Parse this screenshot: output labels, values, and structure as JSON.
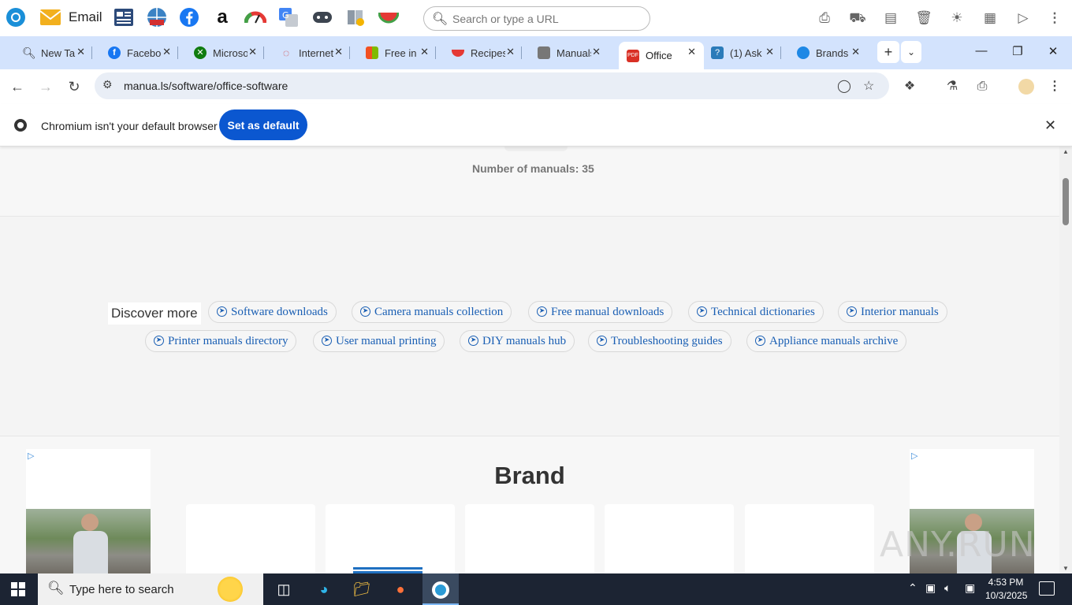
{
  "appbar": {
    "email_label": "Email",
    "search_placeholder": "Search or type a URL"
  },
  "tabs": [
    {
      "title": "New Tab",
      "icon": "search-icon",
      "color": "#333333"
    },
    {
      "title": "Facebook",
      "icon": "facebook-icon",
      "color": "#1877f2"
    },
    {
      "title": "Microsoft",
      "icon": "xbox-icon",
      "color": "#107c10"
    },
    {
      "title": "Internet",
      "icon": "speedometer-icon",
      "color": "#d32f2f"
    },
    {
      "title": "Free in",
      "icon": "microsoft-logo-icon",
      "color": "#f25022"
    },
    {
      "title": "Recipes",
      "icon": "watermelon-icon",
      "color": "#e53935"
    },
    {
      "title": "Manuals",
      "icon": "manual-icon",
      "color": "#555555"
    },
    {
      "title": "Office s",
      "icon": "pdf-icon",
      "color": "#d93025"
    },
    {
      "title": "(1) Ask",
      "icon": "ask-icon",
      "color": "#2b7bb9"
    },
    {
      "title": "Brands",
      "icon": "brands-icon",
      "color": "#1e88e5"
    }
  ],
  "toolbar": {
    "url": "manua.ls/software/office-software"
  },
  "infobar": {
    "message": "Chromium isn't your default browser",
    "button": "Set as default"
  },
  "page": {
    "count_label": "Number of manuals: 35",
    "discover_label": "Discover more",
    "chips": [
      "Software downloads",
      "Camera manuals collection",
      "Free manual downloads",
      "Technical dictionaries",
      "Interior manuals",
      "Printer manuals directory",
      "User manual printing",
      "DIY manuals hub",
      "Troubleshooting guides",
      "Appliance manuals archive"
    ],
    "brand_title": "Brand"
  },
  "watermark": "ANY.RUN",
  "taskbar": {
    "search_text": "Type here to search",
    "time": "4:53 PM",
    "date": "10/3/2025"
  }
}
